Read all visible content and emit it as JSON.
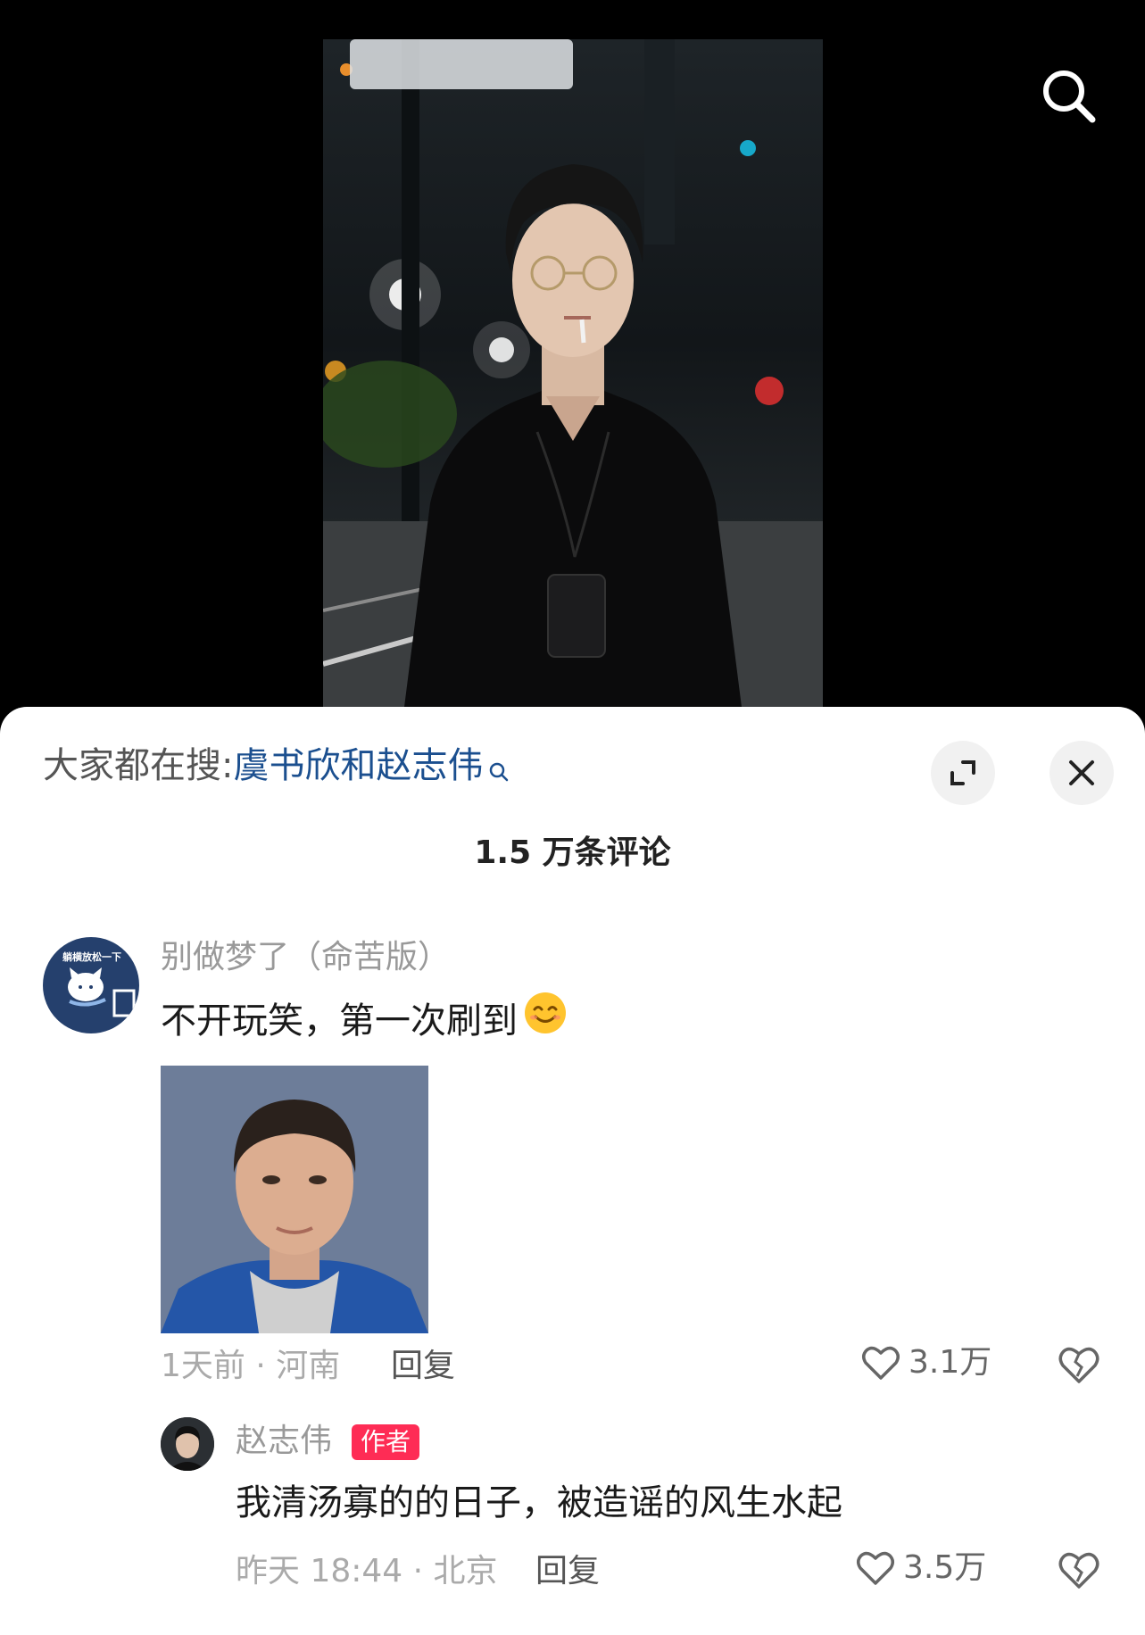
{
  "hot_search": {
    "prefix": "大家都在搜:",
    "term": "虞书欣和赵志伟"
  },
  "comment_count": "1.5 万条评论",
  "comments": [
    {
      "avatar_text": "躺横放松一下",
      "username": "别做梦了（命苦版）",
      "text": "不开玩笑，第一次刷到",
      "time_location": "1天前 · 河南",
      "reply_label": "回复",
      "likes": "3.1万",
      "replies": [
        {
          "username": "赵志伟",
          "badge": "作者",
          "text": "我清汤寡的的日子，被造谣的风生水起",
          "time_location": "昨天 18:44 · 北京",
          "reply_label": "回复",
          "likes": "3.5万"
        }
      ]
    }
  ],
  "colors": {
    "hot_term": "#1b4f8f",
    "author_badge": "#fe2c55",
    "sheet_background": "#ffffff"
  },
  "icons": [
    "search-icon",
    "expand-icon",
    "close-icon",
    "heart-icon",
    "broken-heart-icon",
    "smile-emoji"
  ]
}
